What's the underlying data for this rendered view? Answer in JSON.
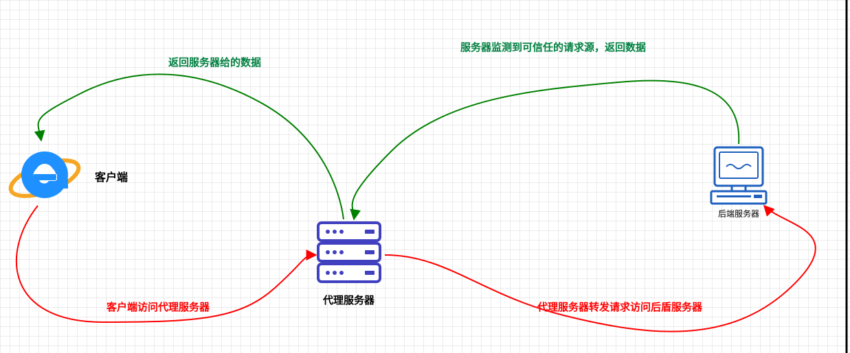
{
  "nodes": {
    "client": {
      "label": "客户端"
    },
    "proxy": {
      "label": "代理服务器"
    },
    "backend": {
      "label": "后端服务器"
    }
  },
  "arrows": {
    "client_to_proxy": {
      "label": "客户端访问代理服务器"
    },
    "proxy_to_backend": {
      "label": "代理服务器转发请求访问后盾服务器"
    },
    "backend_to_proxy": {
      "label": "服务器监测到可信任的请求源，返回数据"
    },
    "proxy_to_client": {
      "label": "返回服务器给的数据"
    }
  },
  "colors": {
    "request": "#ff0000",
    "response": "#008000",
    "client_icon": "#1e90ff",
    "proxy_icon": "#4040c0",
    "backend_icon": "#1e5fbf"
  }
}
